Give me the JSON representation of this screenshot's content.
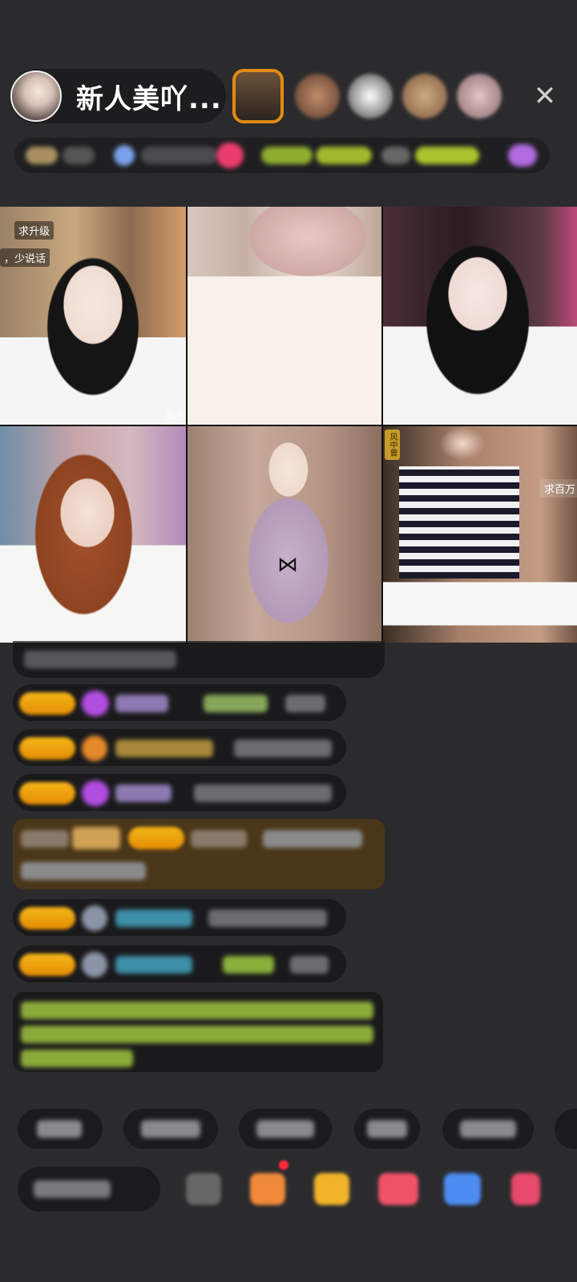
{
  "header": {
    "host_name": "新人美吖...",
    "close_label": "✕"
  },
  "video_grid": {
    "tags": [
      "求升级",
      "，少说话",
      "猫子哥",
      "求百万",
      "风中曾"
    ]
  },
  "icons": {
    "close": "close-icon",
    "gift": "gift-icon"
  }
}
